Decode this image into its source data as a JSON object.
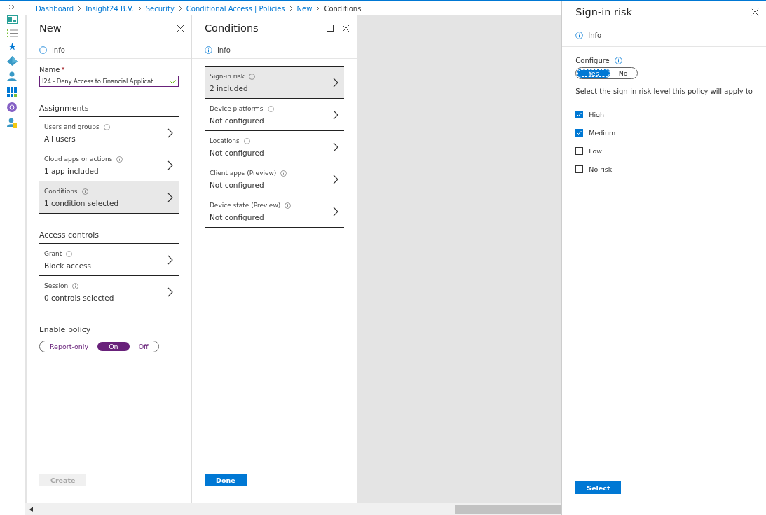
{
  "breadcrumb": [
    {
      "label": "Dashboard",
      "current": false
    },
    {
      "label": "Insight24 B.V.",
      "current": false
    },
    {
      "label": "Security",
      "current": false
    },
    {
      "label": "Conditional Access | Policies",
      "current": false
    },
    {
      "label": "New",
      "current": false
    },
    {
      "label": "Conditions",
      "current": true
    }
  ],
  "new_blade": {
    "title": "New",
    "info": "Info",
    "name_field": {
      "label": "Name",
      "required_mark": "*",
      "value": "I24 - Deny Access to Financial Applicat...",
      "valid": true
    },
    "sections": [
      {
        "heading": "Assignments",
        "items": [
          {
            "label": "Users and groups",
            "value": "All users",
            "selected": false
          },
          {
            "label": "Cloud apps or actions",
            "value": "1 app included",
            "selected": false
          },
          {
            "label": "Conditions",
            "value": "1 condition selected",
            "selected": true
          }
        ]
      },
      {
        "heading": "Access controls",
        "items": [
          {
            "label": "Grant",
            "value": "Block access",
            "selected": false
          },
          {
            "label": "Session",
            "value": "0 controls selected",
            "selected": false
          }
        ]
      }
    ],
    "enable_policy": {
      "label": "Enable policy",
      "options": [
        {
          "label": "Report-only",
          "selected": false
        },
        {
          "label": "On",
          "selected": true
        },
        {
          "label": "Off",
          "selected": false
        }
      ]
    },
    "button": {
      "label": "Create",
      "disabled": true
    }
  },
  "conditions_blade": {
    "title": "Conditions",
    "info": "Info",
    "items": [
      {
        "label": "Sign-in risk",
        "value": "2 included",
        "selected": true
      },
      {
        "label": "Device platforms",
        "value": "Not configured",
        "selected": false
      },
      {
        "label": "Locations",
        "value": "Not configured",
        "selected": false
      },
      {
        "label": "Client apps (Preview)",
        "value": "Not configured",
        "selected": false
      },
      {
        "label": "Device state (Preview)",
        "value": "Not configured",
        "selected": false
      }
    ],
    "button": {
      "label": "Done",
      "disabled": false
    }
  },
  "sign_in_risk": {
    "title": "Sign-in risk",
    "info": "Info",
    "configure": {
      "label": "Configure",
      "options": [
        {
          "label": "Yes",
          "selected": true
        },
        {
          "label": "No",
          "selected": false
        }
      ]
    },
    "instruction": "Select the sign-in risk level this policy will apply to",
    "levels": [
      {
        "label": "High",
        "checked": true
      },
      {
        "label": "Medium",
        "checked": true
      },
      {
        "label": "Low",
        "checked": false
      },
      {
        "label": "No risk",
        "checked": false
      }
    ],
    "button": {
      "label": "Select",
      "disabled": false
    }
  }
}
